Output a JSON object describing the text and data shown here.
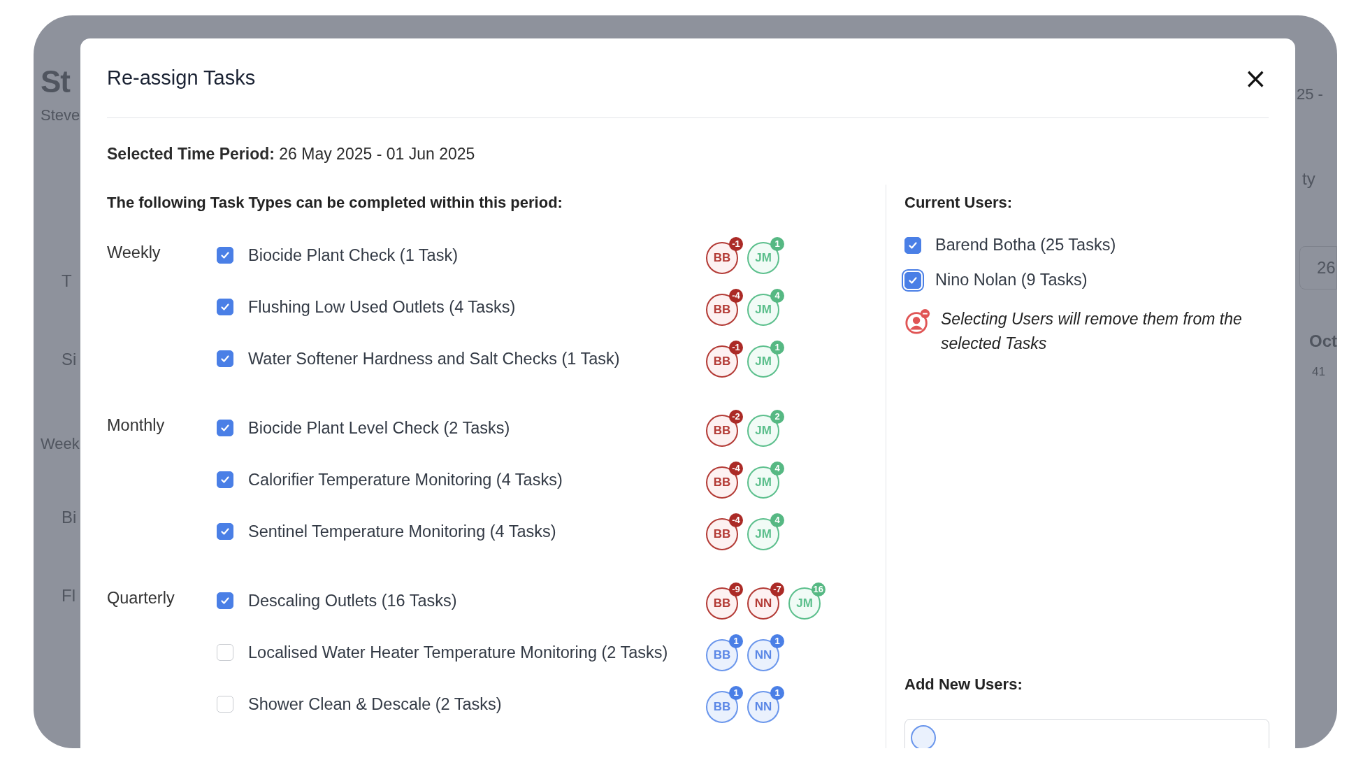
{
  "background": {
    "left": [
      {
        "text": "St",
        "kind": "heading"
      },
      {
        "text": "Steve",
        "kind": "sub"
      },
      {
        "text": "T",
        "kind": "card"
      },
      {
        "text": "Si",
        "kind": "card"
      },
      {
        "text": "Week",
        "kind": "label"
      },
      {
        "text": "Bi",
        "kind": "card"
      },
      {
        "text": "Fl",
        "kind": "card"
      }
    ],
    "right": [
      {
        "text": "25 -",
        "kind": "sub"
      },
      {
        "text": "ty",
        "kind": "label"
      },
      {
        "text": "26",
        "kind": "input"
      },
      {
        "text": "Oct",
        "kind": "heading"
      },
      {
        "text": "41",
        "kind": "small"
      }
    ]
  },
  "modal": {
    "title": "Re-assign Tasks",
    "close": "×",
    "period_label": "Selected Time Period:",
    "period_value": "26 May 2025 - 01 Jun 2025",
    "tasks_heading": "The following Task Types can be completed within this period:",
    "groups": [
      {
        "name": "Weekly",
        "tasks": [
          {
            "label": "Biocide Plant Check (1 Task)",
            "checked": true,
            "avatars": [
              {
                "initials": "BB",
                "kind": "remove",
                "count": "-1"
              },
              {
                "initials": "JM",
                "kind": "add",
                "count": "1"
              }
            ]
          },
          {
            "label": "Flushing Low Used Outlets (4 Tasks)",
            "checked": true,
            "avatars": [
              {
                "initials": "BB",
                "kind": "remove",
                "count": "-4"
              },
              {
                "initials": "JM",
                "kind": "add",
                "count": "4"
              }
            ]
          },
          {
            "label": "Water Softener Hardness and Salt Checks (1 Task)",
            "checked": true,
            "avatars": [
              {
                "initials": "BB",
                "kind": "remove",
                "count": "-1"
              },
              {
                "initials": "JM",
                "kind": "add",
                "count": "1"
              }
            ]
          }
        ]
      },
      {
        "name": "Monthly",
        "tasks": [
          {
            "label": "Biocide Plant Level Check (2 Tasks)",
            "checked": true,
            "avatars": [
              {
                "initials": "BB",
                "kind": "remove",
                "count": "-2"
              },
              {
                "initials": "JM",
                "kind": "add",
                "count": "2"
              }
            ]
          },
          {
            "label": "Calorifier Temperature Monitoring (4 Tasks)",
            "checked": true,
            "avatars": [
              {
                "initials": "BB",
                "kind": "remove",
                "count": "-4"
              },
              {
                "initials": "JM",
                "kind": "add",
                "count": "4"
              }
            ]
          },
          {
            "label": "Sentinel Temperature Monitoring (4 Tasks)",
            "checked": true,
            "avatars": [
              {
                "initials": "BB",
                "kind": "remove",
                "count": "-4"
              },
              {
                "initials": "JM",
                "kind": "add",
                "count": "4"
              }
            ]
          }
        ]
      },
      {
        "name": "Quarterly",
        "tasks": [
          {
            "label": "Descaling Outlets (16 Tasks)",
            "checked": true,
            "avatars": [
              {
                "initials": "BB",
                "kind": "remove",
                "count": "-9"
              },
              {
                "initials": "NN",
                "kind": "remove",
                "count": "-7"
              },
              {
                "initials": "JM",
                "kind": "add",
                "count": "16"
              }
            ]
          },
          {
            "label": "Localised Water Heater Temperature Monitoring (2 Tasks)",
            "checked": false,
            "avatars": [
              {
                "initials": "BB",
                "kind": "assigned",
                "count": "1"
              },
              {
                "initials": "NN",
                "kind": "assigned",
                "count": "1"
              }
            ]
          },
          {
            "label": "Shower Clean & Descale (2 Tasks)",
            "checked": false,
            "avatars": [
              {
                "initials": "BB",
                "kind": "assigned",
                "count": "1"
              },
              {
                "initials": "NN",
                "kind": "assigned",
                "count": "1"
              }
            ]
          }
        ]
      }
    ],
    "current_users_heading": "Current Users:",
    "current_users": [
      {
        "label": "Barend Botha (25 Tasks)",
        "checked": true,
        "focused": false
      },
      {
        "label": "Nino Nolan (9 Tasks)",
        "checked": true,
        "focused": true
      }
    ],
    "note": "Selecting Users will remove them from the selected Tasks",
    "add_users_heading": "Add New Users:"
  }
}
